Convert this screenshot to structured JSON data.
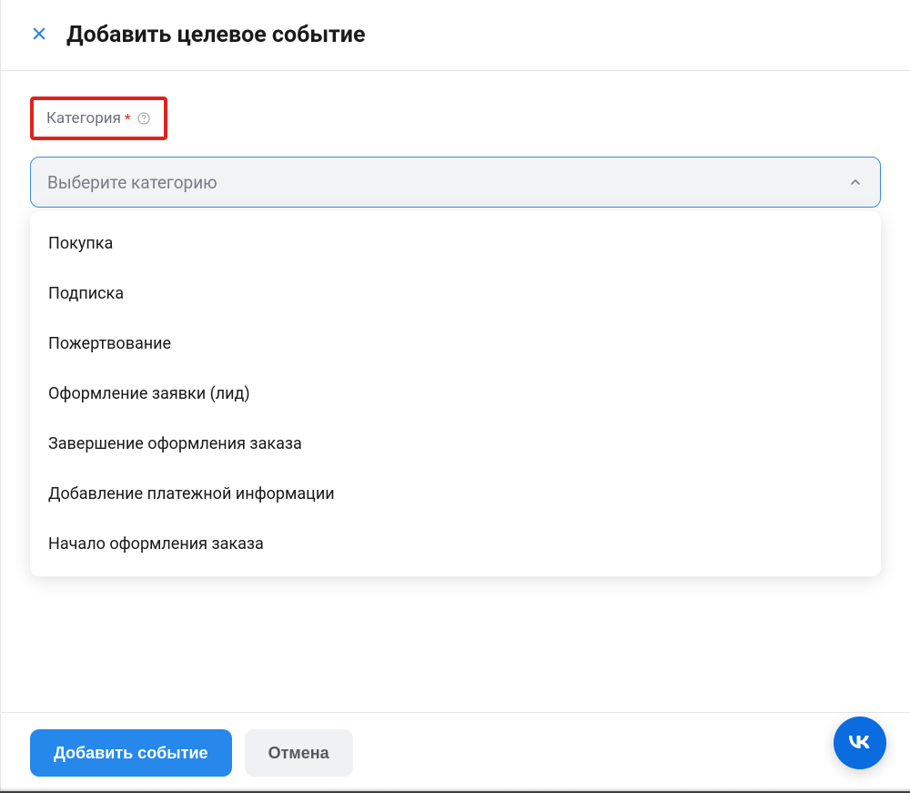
{
  "modal": {
    "title": "Добавить целевое событие"
  },
  "form": {
    "category_label": "Категория",
    "required_mark": "*",
    "select_placeholder": "Выберите категорию",
    "options": [
      "Покупка",
      "Подписка",
      "Пожертвование",
      "Оформление заявки (лид)",
      "Завершение оформления заказа",
      "Добавление платежной информации",
      "Начало оформления заказа"
    ]
  },
  "footer": {
    "primary": "Добавить событие",
    "secondary": "Отмена"
  }
}
